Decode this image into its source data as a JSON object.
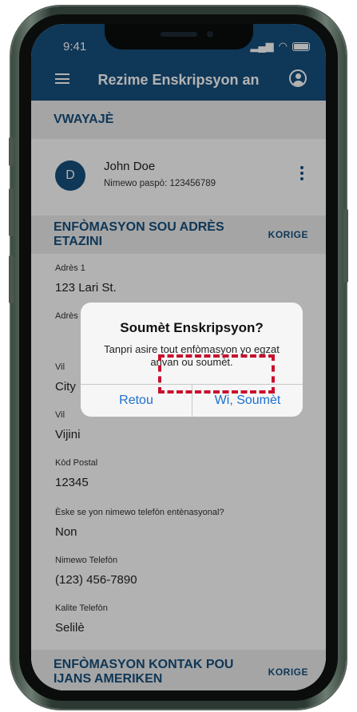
{
  "status_bar": {
    "time": "9:41"
  },
  "header": {
    "title": "Rezime Enskripsyon an"
  },
  "travelers_section": {
    "title": "VWAYAJÈ"
  },
  "traveler": {
    "initial": "D",
    "name": "John Doe",
    "passport": "Nimewo paspò: 123456789"
  },
  "address_section": {
    "title": "ENFÒMASYON SOU ADRÈS ETAZINI",
    "edit_label": "KORIGE",
    "fields": [
      {
        "label": "Adrès 1",
        "value": "123 Lari St."
      },
      {
        "label": "Adrès",
        "value": ""
      },
      {
        "label": "Vil",
        "value": "City"
      },
      {
        "label": "Vil",
        "value": "Vijini"
      },
      {
        "label": "Kòd Postal",
        "value": "12345"
      },
      {
        "label": "Èske se yon nimewo telefòn entènasyonal?",
        "value": "Non"
      },
      {
        "label": "Nimewo Telefòn",
        "value": "(123) 456-7890"
      },
      {
        "label": "Kalite Telefòn",
        "value": "Selilè"
      }
    ]
  },
  "contact_section": {
    "title_line1": "ENFÒMASYON KONTAK POU",
    "title_line2": "IJANS AMERIKEN",
    "edit_label": "KORIGE"
  },
  "dialog": {
    "title": "Soumèt Enskripsyon?",
    "message": "Tanpri asire tout enfòmasyon yo egzat anvan ou soumèt.",
    "back_label": "Retou",
    "confirm_label": "Wi, Soumèt"
  },
  "colors": {
    "primary": "#164f7d",
    "highlight": "#c8102e",
    "ios_blue": "#1b6fcf"
  }
}
